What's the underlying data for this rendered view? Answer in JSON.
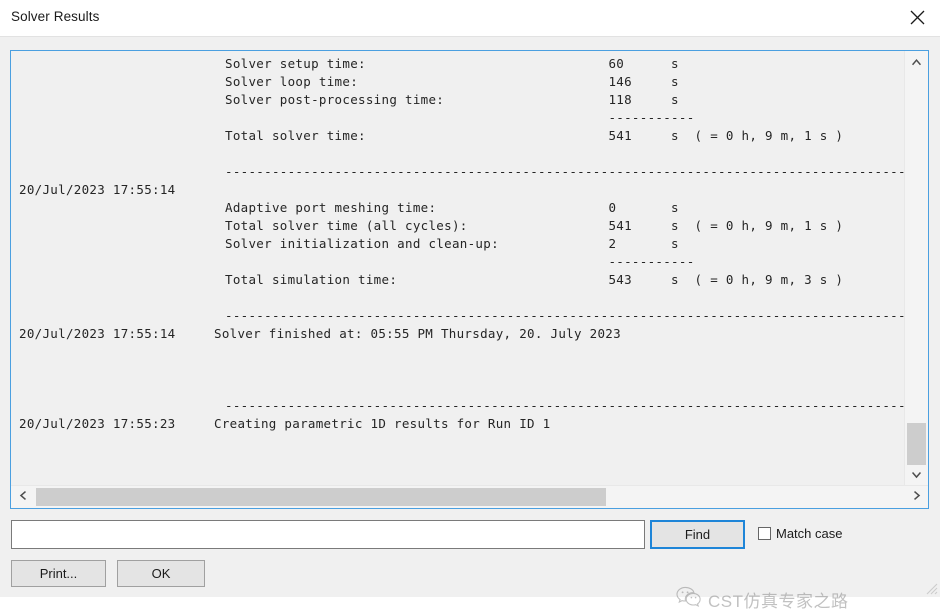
{
  "window": {
    "title": "Solver Results",
    "close_icon": "close-icon"
  },
  "log": {
    "rows": [
      {
        "ts": "",
        "msg": "Solver setup time:                               60      s",
        "indent": true
      },
      {
        "ts": "",
        "msg": "Solver loop time:                                146     s",
        "indent": true
      },
      {
        "ts": "",
        "msg": "Solver post-processing time:                     118     s",
        "indent": true
      },
      {
        "ts": "",
        "msg": "                                                 -----------",
        "indent": true
      },
      {
        "ts": "",
        "msg": "Total solver time:                               541     s  ( = 0 h, 9 m, 1 s )",
        "indent": true
      },
      {
        "ts": "",
        "msg": "",
        "indent": true
      },
      {
        "ts": "",
        "msg": "-----------------------------------------------------------------------------------------------",
        "indent": true
      },
      {
        "ts": "20/Jul/2023 17:55:14",
        "msg": "",
        "indent": true
      },
      {
        "ts": "",
        "msg": "Adaptive port meshing time:                      0       s",
        "indent": true
      },
      {
        "ts": "",
        "msg": "Total solver time (all cycles):                  541     s  ( = 0 h, 9 m, 1 s )",
        "indent": true
      },
      {
        "ts": "",
        "msg": "Solver initialization and clean-up:              2       s",
        "indent": true
      },
      {
        "ts": "",
        "msg": "                                                 -----------",
        "indent": true
      },
      {
        "ts": "",
        "msg": "Total simulation time:                           543     s  ( = 0 h, 9 m, 3 s )",
        "indent": true
      },
      {
        "ts": "",
        "msg": "",
        "indent": true
      },
      {
        "ts": "",
        "msg": "-----------------------------------------------------------------------------------------------",
        "indent": true
      },
      {
        "ts": "20/Jul/2023 17:55:14",
        "msg": "Solver finished at: 05:55 PM Thursday, 20. July 2023",
        "indent": false
      },
      {
        "ts": "",
        "msg": "",
        "indent": false
      },
      {
        "ts": "",
        "msg": "",
        "indent": false
      },
      {
        "ts": "",
        "msg": "",
        "indent": false
      },
      {
        "ts": "",
        "msg": "-----------------------------------------------------------------------------------------------",
        "indent": true
      },
      {
        "ts": "20/Jul/2023 17:55:23",
        "msg": "Creating parametric 1D results for Run ID 1",
        "indent": false
      },
      {
        "ts": "",
        "msg": "",
        "indent": false
      },
      {
        "ts": "",
        "msg": "",
        "indent": false
      },
      {
        "ts": "",
        "msg": "",
        "indent": false
      }
    ]
  },
  "scrollbars": {
    "vertical": {
      "up_icon": "chevron-up-icon",
      "down_icon": "chevron-down-icon"
    },
    "horizontal": {
      "left_icon": "chevron-left-icon",
      "right_icon": "chevron-right-icon"
    }
  },
  "find": {
    "value": "",
    "placeholder": "",
    "button_label": "Find",
    "match_case_label": "Match case",
    "match_case_checked": false
  },
  "buttons": {
    "print_label": "Print...",
    "ok_label": "OK"
  },
  "watermark": {
    "text": "CST仿真专家之路",
    "icon": "wechat-icon"
  },
  "colors": {
    "accent": "#4a9fe0",
    "focus": "#1e85d8",
    "dialog_bg": "#f0f0f0",
    "scroll_thumb": "#cdcdcd"
  }
}
